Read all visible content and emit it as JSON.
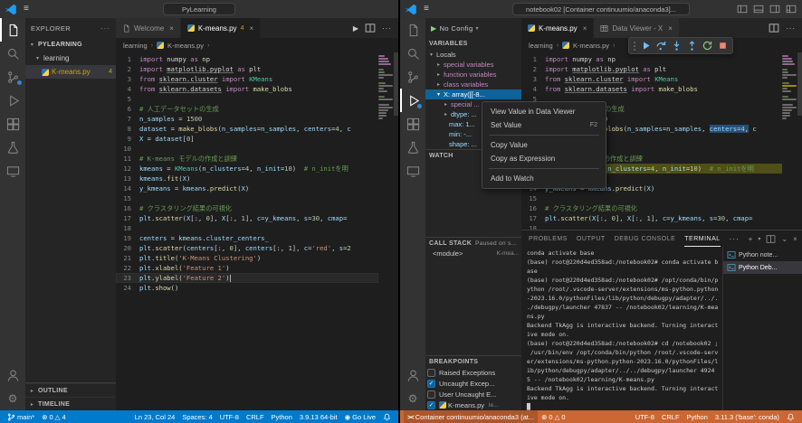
{
  "icons": {
    "menu": "≡",
    "close": "×",
    "more": "···",
    "crumb_sep": "›",
    "twisty_open": "▾",
    "twisty_closed": "▸",
    "run": "▶",
    "caret": "▾",
    "plus": "+",
    "error": "⊗",
    "warning": "△",
    "golive_dot": "◉",
    "gear": "⚙",
    "remote": "><",
    "check": "✓",
    "chevron_down": "⌄"
  },
  "left_window": {
    "title": {
      "command_center": "PyLearning"
    },
    "tabs": [
      {
        "label": "Welcome",
        "active": false
      },
      {
        "label": "K-means.py",
        "badge": "4",
        "active": true
      }
    ],
    "breadcrumb": [
      "learning",
      "K-means.py"
    ],
    "explorer": {
      "header": "EXPLORER",
      "workspace": "PYLEARNING",
      "folder": "learning",
      "file": "K-means.py",
      "file_badge": "4",
      "outline": "OUTLINE",
      "timeline": "TIMELINE"
    },
    "status": {
      "branch": "main*",
      "errors": "0",
      "warnings": "4",
      "line_col": "Ln 23, Col 24",
      "spaces": "Spaces: 4",
      "encoding": "UTF-8",
      "eol": "CRLF",
      "language": "Python",
      "interpreter": "3.9.13 64-bit",
      "go_live": "Go Live"
    }
  },
  "right_window": {
    "title": {
      "command_center": "notebook02 [Container continuumio/anaconda3]..."
    },
    "debug_config": "No Config",
    "tabs": [
      {
        "label": "K-means.py",
        "active": true
      },
      {
        "label": "Data Viewer - X",
        "active": false
      }
    ],
    "breadcrumb": [
      "learning",
      "K-means.py"
    ],
    "variables": {
      "header": "VARIABLES",
      "scope": "Locals",
      "items": [
        "special variables",
        "function variables",
        "class variables"
      ],
      "selected": "X: array([[-8...",
      "children": [
        "special ...",
        "dtype: ...",
        "max: 1...",
        "min: -...",
        "shape: ..."
      ]
    },
    "watch": {
      "header": "WATCH"
    },
    "call_stack": {
      "header": "CALL STACK",
      "note": "Paused on st...",
      "frame": "<module>",
      "location": "K-mea..."
    },
    "breakpoints": {
      "header": "BREAKPOINTS",
      "items": [
        {
          "label": "Raised Exceptions",
          "checked": false
        },
        {
          "label": "Uncaught Excep...",
          "checked": true
        },
        {
          "label": "User Uncaught E...",
          "checked": false
        },
        {
          "label": "K-means.py",
          "checked": true,
          "file": true,
          "detail": "le..."
        }
      ]
    },
    "context_menu": [
      {
        "label": "View Value in Data Viewer"
      },
      {
        "label": "Set Value",
        "shortcut": "F2"
      },
      {
        "separator": true
      },
      {
        "label": "Copy Value"
      },
      {
        "label": "Copy as Expression"
      },
      {
        "separator": true
      },
      {
        "label": "Add to Watch"
      }
    ],
    "panel": {
      "tabs": [
        "PROBLEMS",
        "OUTPUT",
        "DEBUG CONSOLE",
        "TERMINAL"
      ],
      "active_tab": "TERMINAL",
      "terminals": [
        {
          "label": "Python note...",
          "active": false
        },
        {
          "label": "Python Deb...",
          "active": true
        }
      ],
      "terminal_lines": [
        "conda activate base",
        "(base) root@220d4ed358ad:/notebook02# conda activate b",
        "ase",
        "(base) root@220d4ed358ad:/notebook02# /opt/conda/bin/p",
        "ython /root/.vscode-server/extensions/ms-python.python",
        "-2023.16.0/pythonFiles/lib/python/debugpy/adapter/../.",
        "./debugpy/launcher 47837 -- /notebook02/learning/K-mea",
        "ns.py",
        "Backend TkAgg is interactive backend. Turning interact",
        "ive mode on.",
        "(base) root@220d4ed358ad:/notebook02# cd /notebook02 ;",
        " /usr/bin/env /opt/conda/bin/python /root/.vscode-serv",
        "er/extensions/ms-python.python-2023.16.0/pythonFiles/l",
        "ib/python/debugpy/adapter/../../debugpy/launcher 4924",
        "5 -- /notebook02/learning/K-means.py",
        "Backend TkAgg is interactive backend. Turning interact",
        "ive mode on.",
        "█"
      ]
    },
    "status": {
      "remote": "Container continuumio/anaconda3 (at...",
      "errors": "0",
      "warnings": "0",
      "encoding": "UTF-8",
      "eol": "CRLF",
      "language": "Python",
      "interpreter": "3.11.3 ('base': conda)"
    }
  },
  "editors": {
    "left": {
      "cursor_line": 23
    },
    "right": {
      "debug_line": 12,
      "selection_line": 8,
      "selection_from": 8,
      "selection_to": 11
    }
  },
  "code": {
    "lines": [
      [
        [
          "k",
          "import"
        ],
        [
          "d",
          " numpy "
        ],
        [
          "k",
          "as"
        ],
        [
          "d",
          " np"
        ]
      ],
      [
        [
          "k",
          "import"
        ],
        [
          "d",
          " "
        ],
        [
          "m",
          "matplotlib.pyplot"
        ],
        [
          "d",
          " "
        ],
        [
          "k",
          "as"
        ],
        [
          "d",
          " plt"
        ]
      ],
      [
        [
          "k",
          "from"
        ],
        [
          "d",
          " "
        ],
        [
          "m",
          "sklearn.cluster"
        ],
        [
          "d",
          " "
        ],
        [
          "k",
          "import"
        ],
        [
          "d",
          " "
        ],
        [
          "t",
          "KMeans"
        ]
      ],
      [
        [
          "k",
          "from"
        ],
        [
          "d",
          " "
        ],
        [
          "m",
          "sklearn.datasets"
        ],
        [
          "d",
          " "
        ],
        [
          "k",
          "import"
        ],
        [
          "d",
          " "
        ],
        [
          "f",
          "make_blobs"
        ]
      ],
      [],
      [
        [
          "c",
          "# 人工データセットの生成"
        ]
      ],
      [
        [
          "v",
          "n_samples"
        ],
        [
          "d",
          " = "
        ],
        [
          "n",
          "1500"
        ]
      ],
      [
        [
          "v",
          "dataset"
        ],
        [
          "d",
          " = "
        ],
        [
          "f",
          "make_blobs"
        ],
        [
          "d",
          "("
        ],
        [
          "v",
          "n_samples"
        ],
        [
          "d",
          "="
        ],
        [
          "v",
          "n_samples"
        ],
        [
          "d",
          ", "
        ],
        [
          "v",
          "centers"
        ],
        [
          "d",
          "="
        ],
        [
          "n",
          "4"
        ],
        [
          "d",
          ","
        ],
        [
          "d",
          " "
        ],
        [
          "v",
          "c"
        ]
      ],
      [
        [
          "v",
          "X"
        ],
        [
          "d",
          " = "
        ],
        [
          "v",
          "dataset"
        ],
        [
          "d",
          "["
        ],
        [
          "n",
          "0"
        ],
        [
          "d",
          "]"
        ]
      ],
      [],
      [
        [
          "c",
          "# K-means モデルの作成と訓練"
        ]
      ],
      [
        [
          "v",
          "kmeans"
        ],
        [
          "d",
          " = "
        ],
        [
          "t",
          "KMeans"
        ],
        [
          "d",
          "("
        ],
        [
          "v",
          "n_clusters"
        ],
        [
          "d",
          "="
        ],
        [
          "n",
          "4"
        ],
        [
          "d",
          ", "
        ],
        [
          "v",
          "n_init"
        ],
        [
          "d",
          "="
        ],
        [
          "n",
          "10"
        ],
        [
          "d",
          ")  "
        ],
        [
          "c",
          "# n_initを明"
        ]
      ],
      [
        [
          "v",
          "kmeans"
        ],
        [
          "d",
          "."
        ],
        [
          "f",
          "fit"
        ],
        [
          "d",
          "("
        ],
        [
          "v",
          "X"
        ],
        [
          "d",
          ")"
        ]
      ],
      [
        [
          "v",
          "y_kmeans"
        ],
        [
          "d",
          " = "
        ],
        [
          "v",
          "kmeans"
        ],
        [
          "d",
          "."
        ],
        [
          "f",
          "predict"
        ],
        [
          "d",
          "("
        ],
        [
          "v",
          "X"
        ],
        [
          "d",
          ")"
        ]
      ],
      [],
      [
        [
          "c",
          "# クラスタリング結果の可視化"
        ]
      ],
      [
        [
          "v",
          "plt"
        ],
        [
          "d",
          "."
        ],
        [
          "f",
          "scatter"
        ],
        [
          "d",
          "("
        ],
        [
          "v",
          "X"
        ],
        [
          "d",
          "[:, "
        ],
        [
          "n",
          "0"
        ],
        [
          "d",
          "], "
        ],
        [
          "v",
          "X"
        ],
        [
          "d",
          "[:, "
        ],
        [
          "n",
          "1"
        ],
        [
          "d",
          "], "
        ],
        [
          "v",
          "c"
        ],
        [
          "d",
          "="
        ],
        [
          "v",
          "y_kmeans"
        ],
        [
          "d",
          ", "
        ],
        [
          "v",
          "s"
        ],
        [
          "d",
          "="
        ],
        [
          "n",
          "30"
        ],
        [
          "d",
          ", "
        ],
        [
          "v",
          "cmap"
        ],
        [
          "d",
          "="
        ]
      ],
      [],
      [
        [
          "v",
          "centers"
        ],
        [
          "d",
          " = "
        ],
        [
          "v",
          "kmeans"
        ],
        [
          "d",
          "."
        ],
        [
          "v",
          "cluster_centers_"
        ]
      ],
      [
        [
          "v",
          "plt"
        ],
        [
          "d",
          "."
        ],
        [
          "f",
          "scatter"
        ],
        [
          "d",
          "("
        ],
        [
          "v",
          "centers"
        ],
        [
          "d",
          "[:, "
        ],
        [
          "n",
          "0"
        ],
        [
          "d",
          "], "
        ],
        [
          "v",
          "centers"
        ],
        [
          "d",
          "[:, "
        ],
        [
          "n",
          "1"
        ],
        [
          "d",
          "], "
        ],
        [
          "v",
          "c"
        ],
        [
          "d",
          "="
        ],
        [
          "s",
          "'red'"
        ],
        [
          "d",
          ", "
        ],
        [
          "v",
          "s"
        ],
        [
          "d",
          "="
        ],
        [
          "n",
          "2"
        ]
      ],
      [
        [
          "v",
          "plt"
        ],
        [
          "d",
          "."
        ],
        [
          "f",
          "title"
        ],
        [
          "d",
          "("
        ],
        [
          "s",
          "'K-Means Clustering'"
        ],
        [
          "d",
          ")"
        ]
      ],
      [
        [
          "v",
          "plt"
        ],
        [
          "d",
          "."
        ],
        [
          "f",
          "xlabel"
        ],
        [
          "d",
          "("
        ],
        [
          "s",
          "'Feature 1'"
        ],
        [
          "d",
          ")"
        ]
      ],
      [
        [
          "v",
          "plt"
        ],
        [
          "d",
          "."
        ],
        [
          "f",
          "ylabel"
        ],
        [
          "d",
          "("
        ],
        [
          "s",
          "'Feature 2'"
        ],
        [
          "d",
          ")"
        ]
      ],
      [
        [
          "v",
          "plt"
        ],
        [
          "d",
          "."
        ],
        [
          "f",
          "show"
        ],
        [
          "d",
          "()"
        ]
      ]
    ]
  }
}
